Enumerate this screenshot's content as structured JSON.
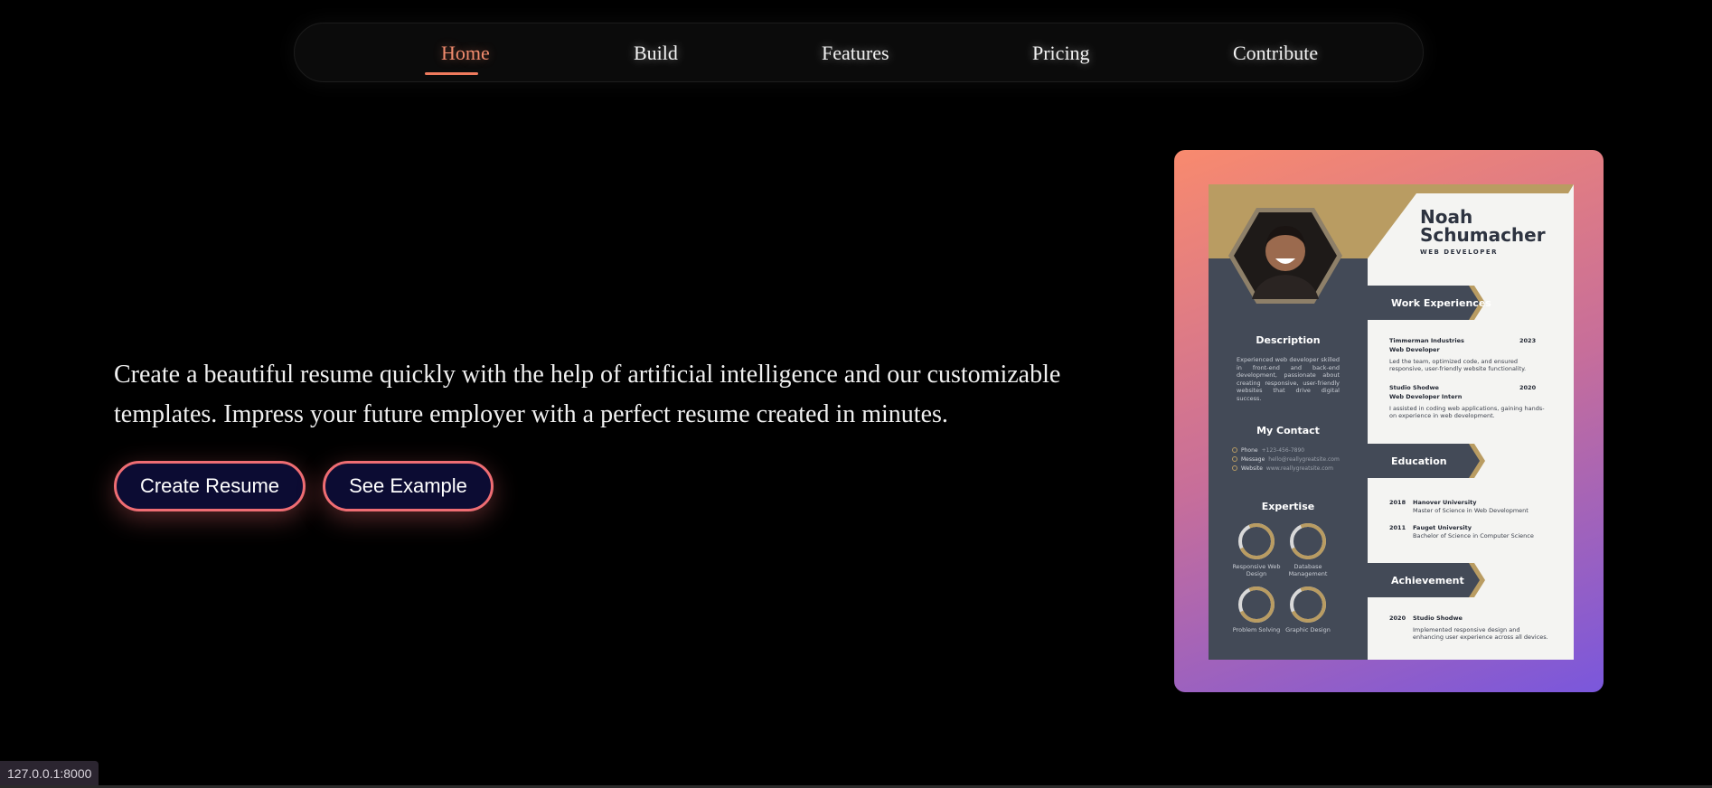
{
  "nav": {
    "items": [
      {
        "label": "Home",
        "active": true
      },
      {
        "label": "Build"
      },
      {
        "label": "Features"
      },
      {
        "label": "Pricing"
      },
      {
        "label": "Contribute"
      }
    ]
  },
  "hero": {
    "text": "Create a beautiful resume quickly with the help of artificial intelligence and our customizable templates. Impress your future employer with a perfect resume created in minutes.",
    "create_button": "Create Resume",
    "example_button": "See Example"
  },
  "resume": {
    "name_line1": "Noah",
    "name_line2": "Schumacher",
    "role": "WEB DEVELOPER",
    "description_title": "Description",
    "description": "Experienced web developer skilled in front-end and back-end development, passionate about creating responsive, user-friendly websites that drive digital success.",
    "contact_title": "My Contact",
    "contacts": [
      {
        "label": "Phone",
        "value": "+123-456-7890"
      },
      {
        "label": "Message",
        "value": "hello@reallygreatsite.com"
      },
      {
        "label": "Website",
        "value": "www.reallygreatsite.com"
      }
    ],
    "expertise_title": "Expertise",
    "skills": [
      "Responsive Web Design",
      "Database Management",
      "Problem Solving",
      "Graphic Design"
    ],
    "work_title": "Work Experiences",
    "work": [
      {
        "company": "Timmerman Industries",
        "year": "2023",
        "role": "Web Developer",
        "text": "Led the team, optimized code, and ensured responsive, user-friendly website functionality."
      },
      {
        "company": "Studio Shodwe",
        "year": "2020",
        "role": "Web Developer Intern",
        "text": "I assisted in coding web applications, gaining hands-on experience in web development."
      }
    ],
    "education_title": "Education",
    "education": [
      {
        "year": "2018",
        "school": "Hanover University",
        "degree": "Master of Science in Web Development"
      },
      {
        "year": "2011",
        "school": "Fauget University",
        "degree": "Bachelor of Science in Computer Science"
      }
    ],
    "achievement_title": "Achievement",
    "achievement": {
      "year": "2020",
      "org": "Studio Shodwe",
      "text": "Implemented responsive design and enhancing user experience across all devices."
    }
  },
  "status": {
    "url": "127.0.0.1:8000"
  },
  "colors": {
    "accent": "#ef7a5d",
    "button_bg": "#0c0c33",
    "resume_gold": "#b99c62",
    "resume_slate": "#434a57"
  }
}
